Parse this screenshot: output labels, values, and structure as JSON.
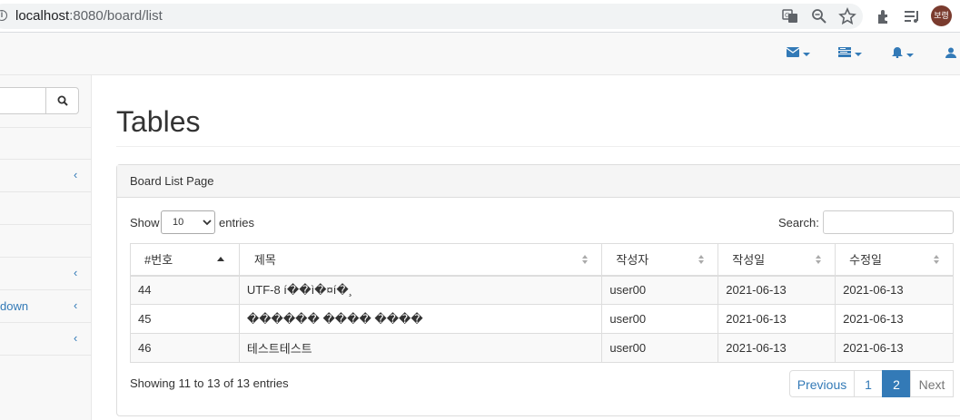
{
  "browser": {
    "url_host": "localhost",
    "url_path": ":8080/board/list",
    "avatar_text": "보령"
  },
  "sidebar": {
    "items": [
      {
        "label": "",
        "chevron": false
      },
      {
        "label": "",
        "chevron": true
      },
      {
        "label": "",
        "chevron": false
      },
      {
        "label": "",
        "chevron": false
      },
      {
        "label": "",
        "chevron": true
      },
      {
        "label": "down",
        "chevron": true
      },
      {
        "label": "",
        "chevron": true
      }
    ]
  },
  "main": {
    "title": "Tables",
    "panel_heading": "Board List Page",
    "length_prefix": "Show",
    "length_value": "10",
    "length_suffix": "entries",
    "search_label": "Search:",
    "search_value": "",
    "columns": [
      "#번호",
      "제목",
      "작성자",
      "작성일",
      "수정일"
    ],
    "rows": [
      [
        "44",
        "UTF-8 í��ì�¤í�¸",
        "user00",
        "2021-06-13",
        "2021-06-13"
      ],
      [
        "45",
        "������ ���� ����",
        "user00",
        "2021-06-13",
        "2021-06-13"
      ],
      [
        "46",
        "테스트테스트",
        "user00",
        "2021-06-13",
        "2021-06-13"
      ]
    ],
    "info_text": "Showing 11 to 13 of 13 entries",
    "pager": {
      "previous": "Previous",
      "pages": [
        "1",
        "2"
      ],
      "active_page": "2",
      "next": "Next"
    }
  },
  "colors": {
    "link": "#337ab7",
    "border": "#dddddd"
  }
}
